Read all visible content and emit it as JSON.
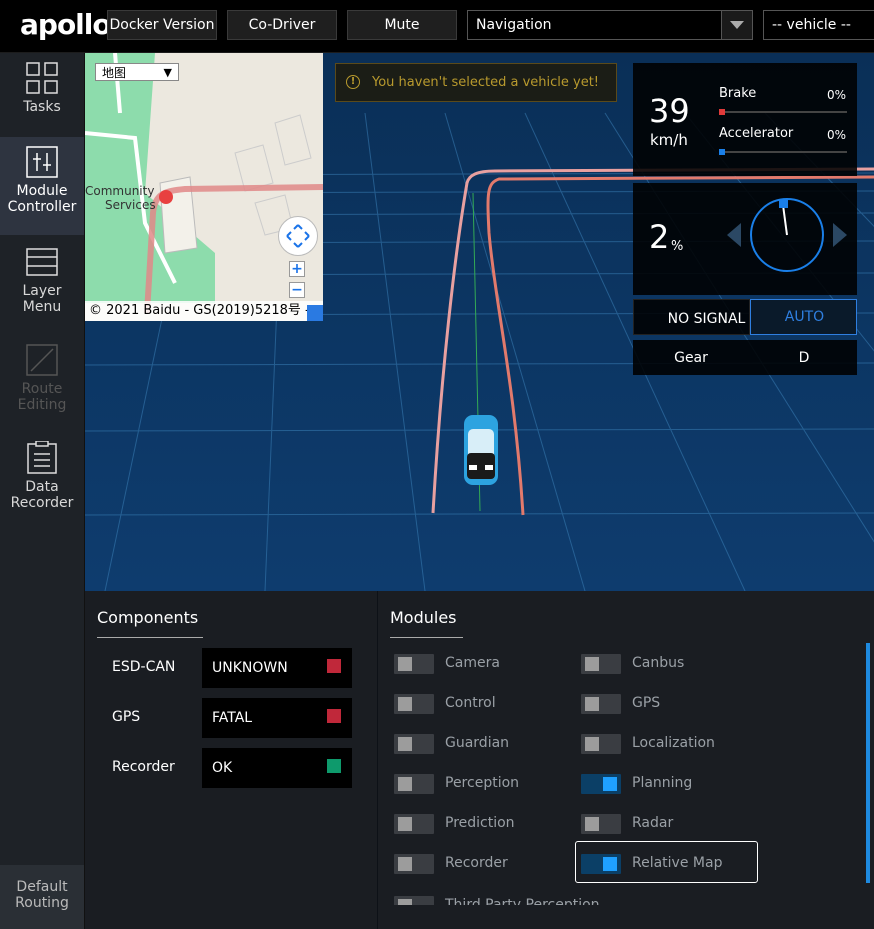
{
  "header": {
    "logo": "apollo",
    "docker_version_label": "Docker Version",
    "co_driver_label": "Co-Driver",
    "mute_label": "Mute",
    "mode_select": "Navigation",
    "vehicle_select": "-- vehicle --"
  },
  "sidebar": {
    "items": [
      {
        "label_line1": "Tasks",
        "label_line2": ""
      },
      {
        "label_line1": "Module",
        "label_line2": "Controller"
      },
      {
        "label_line1": "Layer",
        "label_line2": "Menu"
      },
      {
        "label_line1": "Route",
        "label_line2": "Editing"
      },
      {
        "label_line1": "Data",
        "label_line2": "Recorder"
      }
    ],
    "bottom": {
      "label_line1": "Default",
      "label_line2": "Routing"
    }
  },
  "map": {
    "type_select": "地图",
    "label_community_1": "Community",
    "label_community_2": "Services",
    "copyright": "© 2021 Baidu - GS(2019)5218号 -",
    "zoom_in": "+",
    "zoom_out": "−"
  },
  "warning": {
    "text": "You haven't selected a vehicle yet!"
  },
  "dashboard": {
    "speed": "39",
    "speed_unit": "km/h",
    "brake_label": "Brake",
    "brake_pct": "0%",
    "accelerator_label": "Accelerator",
    "accelerator_pct": "0%",
    "steering_pct": "2",
    "steering_unit": "%",
    "signal": "NO SIGNAL",
    "drive_mode": "AUTO",
    "gear_label": "Gear",
    "gear_value": "D",
    "colors": {
      "brake": "#e03a3a",
      "accelerator": "#1a7fe8",
      "auto": "#2f7fe0"
    }
  },
  "components": {
    "title": "Components",
    "items": [
      {
        "name": "ESD-CAN",
        "status": "UNKNOWN",
        "color": "#c0283a"
      },
      {
        "name": "GPS",
        "status": "FATAL",
        "color": "#c0283a"
      },
      {
        "name": "Recorder",
        "status": "OK",
        "color": "#0e9a6c"
      }
    ]
  },
  "modules": {
    "title": "Modules",
    "left": [
      {
        "name": "Camera",
        "on": false
      },
      {
        "name": "Control",
        "on": false
      },
      {
        "name": "Guardian",
        "on": false
      },
      {
        "name": "Perception",
        "on": false
      },
      {
        "name": "Prediction",
        "on": false
      },
      {
        "name": "Recorder",
        "on": false
      },
      {
        "name": "Third Party Perception",
        "on": false
      }
    ],
    "right": [
      {
        "name": "Canbus",
        "on": false
      },
      {
        "name": "GPS",
        "on": false
      },
      {
        "name": "Localization",
        "on": false
      },
      {
        "name": "Planning",
        "on": true
      },
      {
        "name": "Radar",
        "on": false
      },
      {
        "name": "Relative Map",
        "on": true
      }
    ]
  }
}
